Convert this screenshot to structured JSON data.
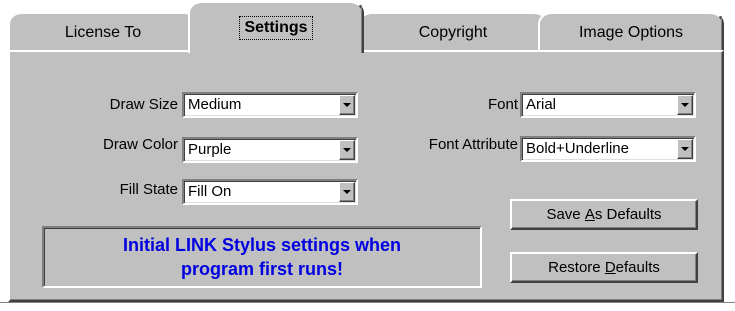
{
  "tabs": [
    {
      "label": "License To",
      "active": false
    },
    {
      "label": "Settings",
      "active": true
    },
    {
      "label": "Copyright",
      "active": false
    },
    {
      "label": "Image Options",
      "active": false
    }
  ],
  "fields": {
    "draw_size": {
      "label": "Draw Size",
      "value": "Medium"
    },
    "draw_color": {
      "label": "Draw Color",
      "value": "Purple"
    },
    "fill_state": {
      "label": "Fill State",
      "value": "Fill On"
    },
    "font": {
      "label": "Font",
      "value": "Arial"
    },
    "font_attribute": {
      "label": "Font Attribute",
      "value": "Bold+Underline"
    }
  },
  "buttons": {
    "save_defaults": {
      "before": "Save ",
      "mnemonic": "A",
      "after": "s Defaults"
    },
    "restore_defaults": {
      "before": "Restore ",
      "mnemonic": "D",
      "after": "efaults"
    }
  },
  "info": {
    "line1": "Initial LINK Stylus settings when",
    "line2": "program first runs!",
    "color": "#0000e0"
  },
  "colors": {
    "face": "#c0c0c0",
    "highlight": "#ffffff",
    "shadow": "#808080",
    "dark_shadow": "#404040"
  },
  "icons": {
    "dropdown": "chevron-down-icon"
  }
}
